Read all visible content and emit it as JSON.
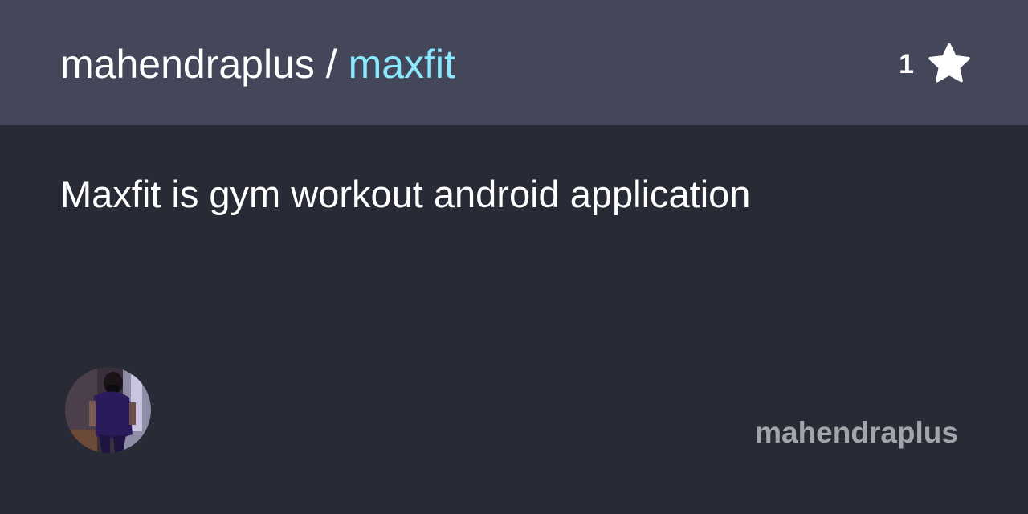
{
  "header": {
    "owner": "mahendraplus",
    "separator": " / ",
    "repo_name": "maxfit",
    "star_count": "1",
    "star_icon": "star-icon"
  },
  "description": "Maxfit is gym workout android application",
  "footer": {
    "owner_name": "mahendraplus",
    "avatar_icon": "avatar-photo"
  },
  "colors": {
    "background": "#282a36",
    "header_background": "#44475a",
    "accent": "#8be9fd",
    "text": "#ffffff",
    "muted_text": "#a4a4ab"
  }
}
